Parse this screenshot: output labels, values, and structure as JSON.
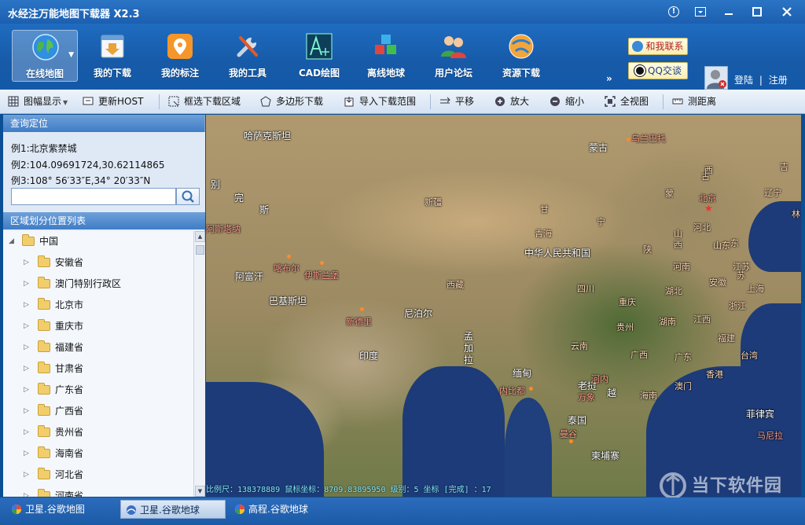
{
  "window": {
    "title": "水经注万能地图下载器 X2.3"
  },
  "toolbar": {
    "buttons": [
      {
        "label": "在线地图",
        "icon": "globe-icon"
      },
      {
        "label": "我的下载",
        "icon": "download-list-icon"
      },
      {
        "label": "我的标注",
        "icon": "map-pin-icon"
      },
      {
        "label": "我的工具",
        "icon": "tools-icon"
      },
      {
        "label": "CAD绘图",
        "icon": "cad-icon"
      },
      {
        "label": "离线地球",
        "icon": "offline-cubes-icon"
      },
      {
        "label": "用户论坛",
        "icon": "users-icon"
      },
      {
        "label": "资源下载",
        "icon": "resource-globe-icon"
      }
    ],
    "more": "»",
    "contact_label": "和我联系",
    "qq_label": "QQ交谈",
    "login": "登陆",
    "divider": "|",
    "register": "注册"
  },
  "subtoolbar": {
    "items": [
      {
        "label": "图幅显示",
        "icon": "grid-icon"
      },
      {
        "label": "更新HOST",
        "icon": "refresh-host-icon"
      },
      {
        "label": "框选下载区域",
        "icon": "select-box-icon"
      },
      {
        "label": "多边形下载",
        "icon": "polygon-icon"
      },
      {
        "label": "导入下载范围",
        "icon": "import-icon"
      },
      {
        "label": "平移",
        "icon": "pan-icon"
      },
      {
        "label": "放大",
        "icon": "zoom-in-icon"
      },
      {
        "label": "缩小",
        "icon": "zoom-out-icon"
      },
      {
        "label": "全视图",
        "icon": "full-view-icon"
      },
      {
        "label": "测距离",
        "icon": "ruler-icon"
      }
    ]
  },
  "query": {
    "title": "查询定位",
    "example1": "例1:北京紫禁城",
    "example2": "例2:104.09691724,30.62114865",
    "example3": "例3:108° 56′33″E,34° 20′33″N",
    "input_value": ""
  },
  "regions": {
    "title": "区域划分位置列表",
    "root": "中国",
    "items": [
      "安徽省",
      "澳门特别行政区",
      "北京市",
      "重庆市",
      "福建省",
      "甘肃省",
      "广东省",
      "广西省",
      "贵州省",
      "海南省",
      "河北省",
      "河南省"
    ]
  },
  "map": {
    "labels": {
      "countries": [
        "哈萨克斯坦",
        "蒙古",
        "中华人民共和国",
        "阿富汗",
        "巴基斯坦",
        "尼泊尔",
        "印度",
        "孟加拉",
        "缅甸",
        "老挝",
        "越",
        "泰国",
        "柬埔寨",
        "菲律宾",
        "完",
        "斯",
        "别"
      ],
      "provinces": [
        "新疆",
        "西藏",
        "青海",
        "甘",
        "宁",
        "陕",
        "山西",
        "河北",
        "山东",
        "辽宁",
        "古",
        "蒙",
        "四川",
        "重庆",
        "湖北",
        "河南",
        "江苏",
        "安徽",
        "上海",
        "浙江",
        "湖南",
        "江西",
        "贵州",
        "云南",
        "广西",
        "广东",
        "福建",
        "台湾",
        "海南",
        "澳门",
        "香港",
        "西",
        "东",
        "苏",
        "吉",
        "林"
      ],
      "cities": [
        "乌兰巴托",
        "北京",
        "阿斯塔纳",
        "喀布尔",
        "伊斯兰堡",
        "新德里",
        "内比都",
        "万象",
        "曼谷",
        "马尼拉",
        "河内"
      ]
    },
    "status": "比例尺：138378889   鼠标坐标：8709.83895950   级别：5   坐标 [完成] ：17"
  },
  "watermark": "当下软件园",
  "tabs": [
    {
      "label": "卫星.谷歌地图",
      "active": false
    },
    {
      "label": "卫星.谷歌地球",
      "active": true
    },
    {
      "label": "高程.谷歌地球",
      "active": false
    }
  ]
}
